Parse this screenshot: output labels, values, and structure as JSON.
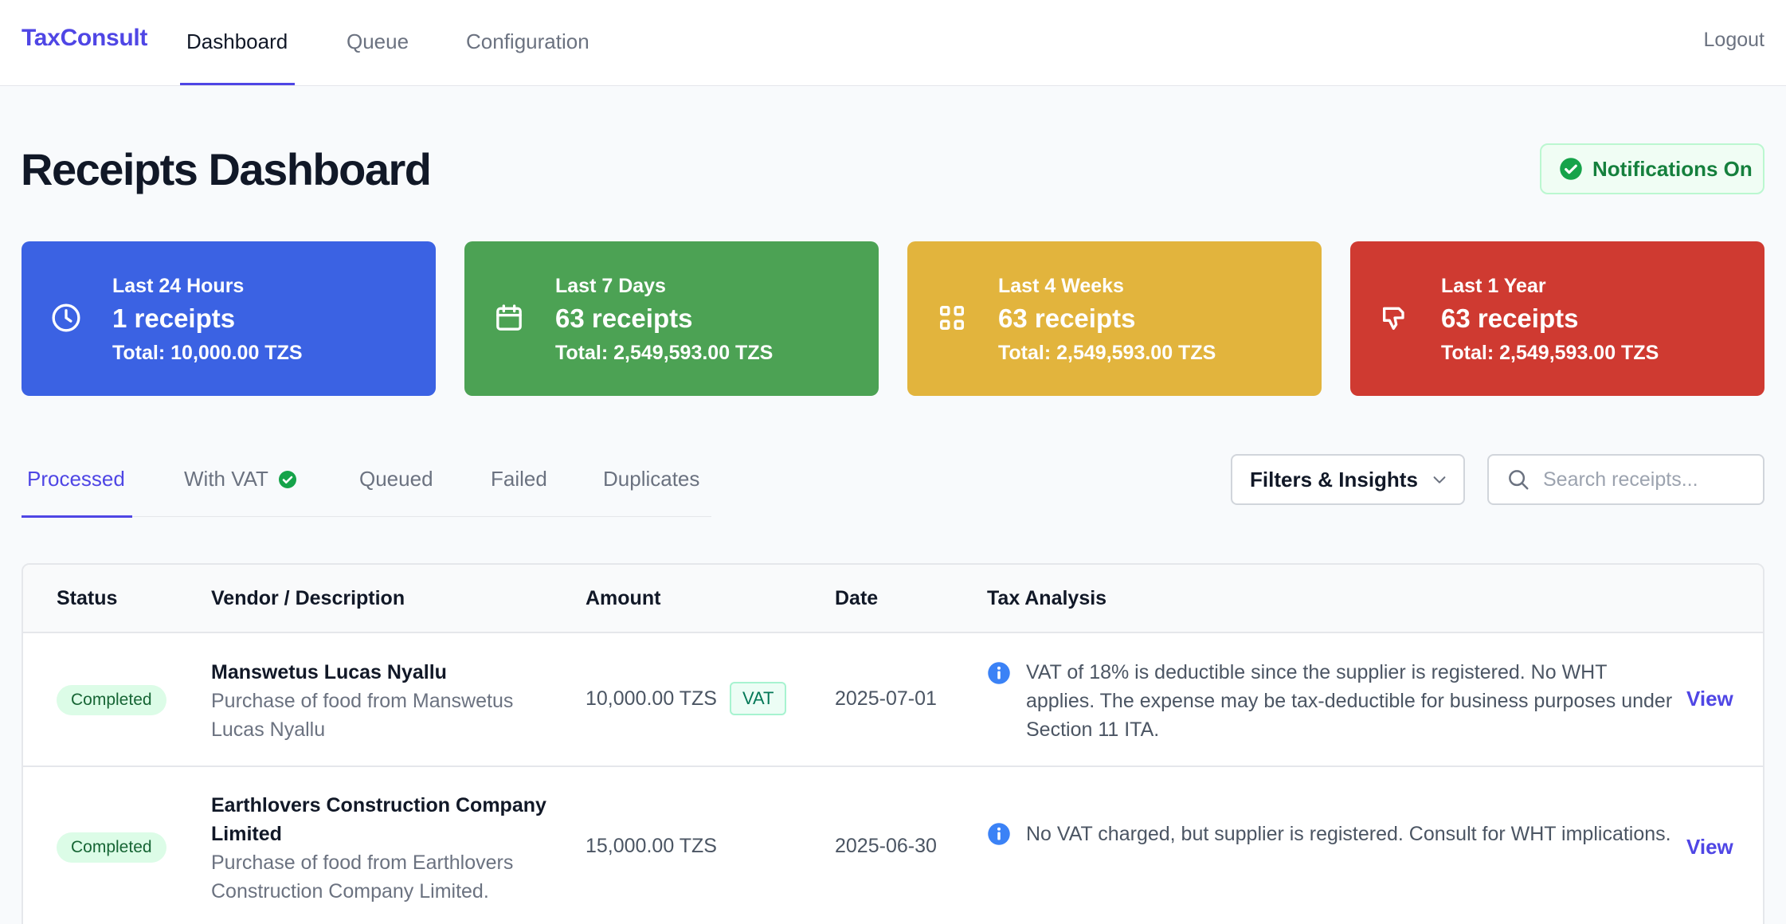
{
  "nav": {
    "brand": "TaxConsult",
    "links": [
      {
        "label": "Dashboard",
        "active": true
      },
      {
        "label": "Queue",
        "active": false
      },
      {
        "label": "Configuration",
        "active": false
      }
    ],
    "logout": "Logout"
  },
  "header": {
    "title": "Receipts Dashboard",
    "notifications": {
      "label": "Notifications On",
      "icon": "check-circle-icon",
      "color": "#15803d"
    }
  },
  "stats": [
    {
      "period": "Last 24 Hours",
      "count": "1 receipts",
      "total": "Total: 10,000.00 TZS",
      "icon": "clock-icon",
      "color": "#3b62e3"
    },
    {
      "period": "Last 7 Days",
      "count": "63 receipts",
      "total": "Total: 2,549,593.00 TZS",
      "icon": "calendar-icon",
      "color": "#4ca254"
    },
    {
      "period": "Last 4 Weeks",
      "count": "63 receipts",
      "total": "Total: 2,549,593.00 TZS",
      "icon": "grid-icon",
      "color": "#e2b43d"
    },
    {
      "period": "Last 1 Year",
      "count": "63 receipts",
      "total": "Total: 2,549,593.00 TZS",
      "icon": "thumbs-down-icon",
      "color": "#cf3a31"
    }
  ],
  "tabs": [
    {
      "label": "Processed",
      "active": true
    },
    {
      "label": "With VAT",
      "active": false,
      "icon": "check-circle-icon"
    },
    {
      "label": "Queued",
      "active": false
    },
    {
      "label": "Failed",
      "active": false
    },
    {
      "label": "Duplicates",
      "active": false
    }
  ],
  "filters": {
    "label": "Filters & Insights",
    "icon": "chevron-down-icon"
  },
  "search": {
    "placeholder": "Search receipts...",
    "value": "",
    "icon": "search-icon"
  },
  "table": {
    "columns": [
      "Status",
      "Vendor / Description",
      "Amount",
      "Date",
      "Tax Analysis"
    ],
    "rows": [
      {
        "status": "Completed",
        "vendor": "Manswetus Lucas Nyallu",
        "description": "Purchase of food from Manswetus Lucas Nyallu",
        "amount": "10,000.00 TZS",
        "vat_badge": "VAT",
        "date": "2025-07-01",
        "tax_analysis": "VAT of 18% is deductible since the supplier is registered. No WHT applies. The expense may be tax-deductible for business purposes under Section 11 ITA.",
        "action": "View"
      },
      {
        "status": "Completed",
        "vendor": "Earthlovers Construction Company Limited",
        "description": "Purchase of food from Earthlovers Construction Company Limited.",
        "amount": "15,000.00 TZS",
        "date": "2025-06-30",
        "tax_analysis": "No VAT charged, but supplier is registered. Consult for WHT implications.",
        "action": "View"
      }
    ]
  }
}
